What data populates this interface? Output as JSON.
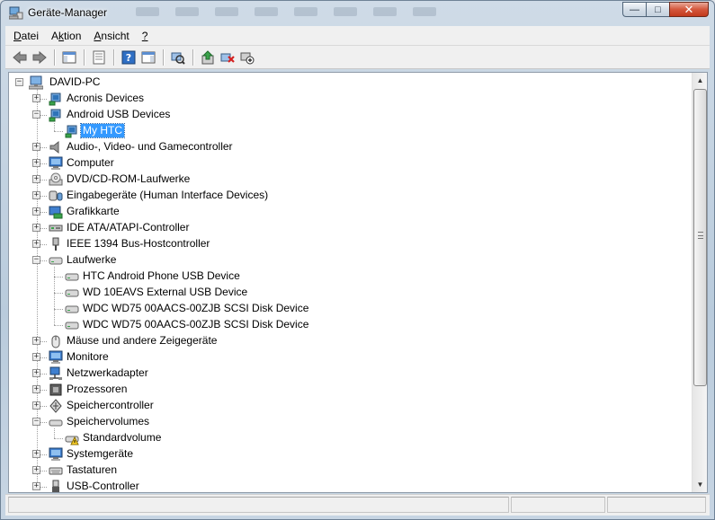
{
  "window": {
    "title": "Geräte-Manager",
    "controls": {
      "minimize": "—",
      "maximize": "□",
      "close": "✕"
    }
  },
  "menu": [
    {
      "label": "Datei",
      "accel": "D",
      "rest": "atei"
    },
    {
      "label": "Aktion",
      "accel": "k",
      "pre": "A",
      "rest": "tion"
    },
    {
      "label": "Ansicht",
      "accel": "A",
      "rest": "nsicht"
    },
    {
      "label": "?",
      "accel": "?",
      "rest": ""
    }
  ],
  "toolbar": {
    "buttons": [
      {
        "name": "back-arrow-icon"
      },
      {
        "name": "forward-arrow-icon"
      },
      {
        "name": "show-hide-console-tree-icon"
      },
      {
        "name": "properties-icon"
      },
      {
        "name": "help-icon"
      },
      {
        "name": "action-pane-icon"
      },
      {
        "name": "scan-hardware-changes-icon"
      },
      {
        "name": "update-driver-icon"
      },
      {
        "name": "uninstall-device-icon"
      },
      {
        "name": "disable-device-icon"
      }
    ]
  },
  "tree": {
    "root": "DAVID-PC",
    "items": [
      {
        "label": "Acronis Devices",
        "icon": "device-chip-icon",
        "level": 1,
        "expanded": false
      },
      {
        "label": "Android USB Devices",
        "icon": "device-chip-icon",
        "level": 1,
        "expanded": true
      },
      {
        "label": "My HTC",
        "icon": "device-chip-icon",
        "level": 2,
        "selected": true
      },
      {
        "label": "Audio-, Video- und Gamecontroller",
        "icon": "speaker-icon",
        "level": 1,
        "expanded": false
      },
      {
        "label": "Computer",
        "icon": "monitor-icon",
        "level": 1,
        "expanded": false
      },
      {
        "label": "DVD/CD-ROM-Laufwerke",
        "icon": "optical-drive-icon",
        "level": 1,
        "expanded": false
      },
      {
        "label": "Eingabegeräte (Human Interface Devices)",
        "icon": "hid-icon",
        "level": 1,
        "expanded": false
      },
      {
        "label": "Grafikkarte",
        "icon": "display-adapter-icon",
        "level": 1,
        "expanded": false
      },
      {
        "label": "IDE ATA/ATAPI-Controller",
        "icon": "ide-controller-icon",
        "level": 1,
        "expanded": false
      },
      {
        "label": "IEEE 1394 Bus-Hostcontroller",
        "icon": "firewire-icon",
        "level": 1,
        "expanded": false
      },
      {
        "label": "Laufwerke",
        "icon": "disk-drive-icon",
        "level": 1,
        "expanded": true
      },
      {
        "label": "HTC Android Phone USB Device",
        "icon": "disk-drive-icon",
        "level": 2
      },
      {
        "label": "WD 10EAVS External USB Device",
        "icon": "disk-drive-icon",
        "level": 2
      },
      {
        "label": "WDC WD75 00AACS-00ZJB SCSI Disk Device",
        "icon": "disk-drive-icon",
        "level": 2
      },
      {
        "label": "WDC WD75 00AACS-00ZJB SCSI Disk Device",
        "icon": "disk-drive-icon",
        "level": 2
      },
      {
        "label": "Mäuse und andere Zeigegeräte",
        "icon": "mouse-icon",
        "level": 1,
        "expanded": false
      },
      {
        "label": "Monitore",
        "icon": "monitor-icon",
        "level": 1,
        "expanded": false
      },
      {
        "label": "Netzwerkadapter",
        "icon": "network-adapter-icon",
        "level": 1,
        "expanded": false
      },
      {
        "label": "Prozessoren",
        "icon": "processor-icon",
        "level": 1,
        "expanded": false
      },
      {
        "label": "Speichercontroller",
        "icon": "storage-controller-icon",
        "level": 1,
        "expanded": false
      },
      {
        "label": "Speichervolumes",
        "icon": "volume-icon",
        "level": 1,
        "expanded": true
      },
      {
        "label": "Standardvolume",
        "icon": "warning-volume-icon",
        "level": 2
      },
      {
        "label": "Systemgeräte",
        "icon": "monitor-icon",
        "level": 1,
        "expanded": false
      },
      {
        "label": "Tastaturen",
        "icon": "keyboard-icon",
        "level": 1,
        "expanded": false
      },
      {
        "label": "USB-Controller",
        "icon": "usb-icon",
        "level": 1,
        "expanded": false
      }
    ]
  },
  "colors": {
    "selection": "#3399ff",
    "window_frame": "#b9cbdc",
    "close_button": "#c23a1d"
  }
}
